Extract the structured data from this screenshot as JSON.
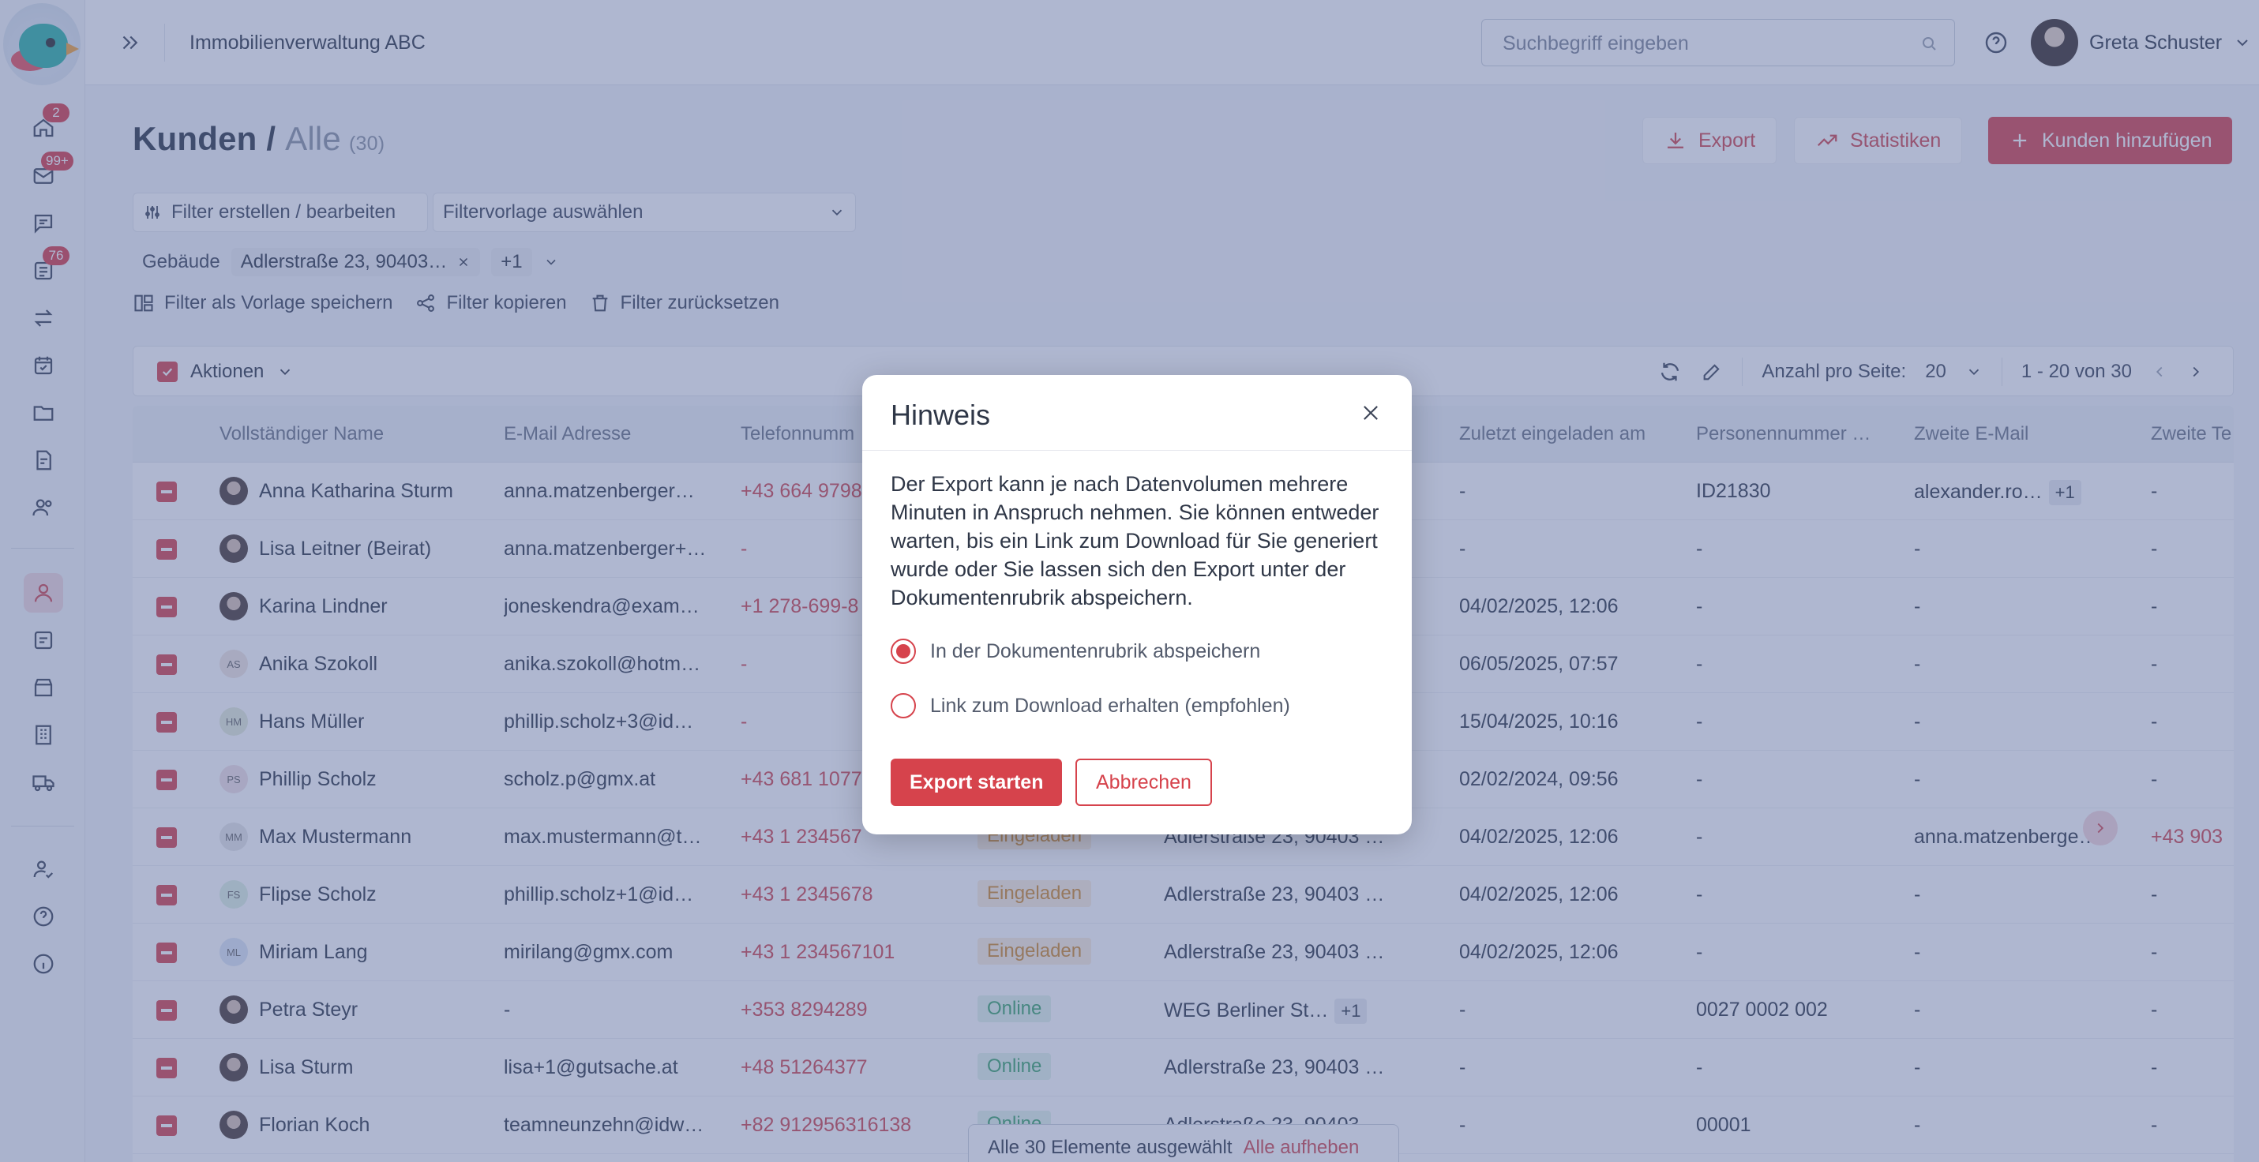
{
  "sidebar": {
    "badges": {
      "home": "2",
      "mail": "99+",
      "tasks": "76"
    }
  },
  "topbar": {
    "app_name": "Immobilienverwaltung ABC",
    "search_placeholder": "Suchbegriff eingeben",
    "user_name": "Greta Schuster"
  },
  "page": {
    "title": "Kunden",
    "separator": " / ",
    "subtitle": "Alle",
    "count": "(30)",
    "export_label": "Export",
    "stats_label": "Statistiken",
    "add_label": "Kunden hinzufügen"
  },
  "filters": {
    "edit_label": "Filter erstellen / bearbeiten",
    "template_placeholder": "Filtervorlage auswählen",
    "building_label": "Gebäude",
    "building_value": "Adlerstraße 23, 90403…",
    "more_count": "+1",
    "save_template": "Filter als Vorlage speichern",
    "copy_filter": "Filter kopieren",
    "reset_filter": "Filter zurücksetzen"
  },
  "toolbar": {
    "actions_label": "Aktionen",
    "per_page_label": "Anzahl pro Seite:",
    "per_page_value": "20",
    "range": "1 - 20 von 30"
  },
  "table": {
    "headers": [
      "Vollständiger Name",
      "E-Mail Adresse",
      "Telefonnumm",
      "Zuletzt eingeladen am",
      "Personennummer …",
      "Zweite E-Mail",
      "Zweite Te"
    ],
    "rows": [
      {
        "name": "Anna Katharina Sturm",
        "email": "anna.matzenberger…",
        "phone": "+43 664 9798",
        "status": "",
        "building": "",
        "invited": "-",
        "pnr": "ID21830",
        "email2": "alexander.ro…",
        "email2_more": "+1",
        "phone2": "-",
        "avatar": "photo"
      },
      {
        "name": "Lisa Leitner (Beirat)",
        "email": "anna.matzenberger+…",
        "phone": "-",
        "status": "",
        "building": "",
        "invited": "-",
        "pnr": "-",
        "email2": "-",
        "email2_more": "",
        "phone2": "-",
        "avatar": "photo"
      },
      {
        "name": "Karina Lindner",
        "email": "joneskendra@exam…",
        "phone": "+1 278-699-8",
        "status": "",
        "building": "",
        "invited": "04/02/2025, 12:06",
        "pnr": "-",
        "email2": "-",
        "email2_more": "",
        "phone2": "-",
        "avatar": "photo"
      },
      {
        "name": "Anika Szokoll",
        "email": "anika.szokoll@hotm…",
        "phone": "-",
        "status": "",
        "building": "",
        "invited": "06/05/2025, 07:57",
        "pnr": "-",
        "email2": "-",
        "email2_more": "",
        "phone2": "-",
        "avatar": "AS"
      },
      {
        "name": "Hans Müller",
        "email": "phillip.scholz+3@id…",
        "phone": "-",
        "status": "",
        "building": "",
        "invited": "15/04/2025, 10:16",
        "pnr": "-",
        "email2": "-",
        "email2_more": "",
        "phone2": "-",
        "avatar": "HM"
      },
      {
        "name": "Phillip Scholz",
        "email": "scholz.p@gmx.at",
        "phone": "+43 681 1077",
        "status": "",
        "building": "",
        "invited": "02/02/2024, 09:56",
        "pnr": "-",
        "email2": "-",
        "email2_more": "",
        "phone2": "-",
        "avatar": "PS"
      },
      {
        "name": "Max Mustermann",
        "email": "max.mustermann@t…",
        "phone": "+43 1 234567",
        "status": "Eingeladen",
        "building": "Adlerstraße 23, 90403 …",
        "invited": "04/02/2025, 12:06",
        "pnr": "-",
        "email2": "anna.matzenberge…",
        "email2_more": "",
        "phone2": "+43 903",
        "avatar": "MM"
      },
      {
        "name": "Flipse Scholz",
        "email": "phillip.scholz+1@id…",
        "phone": "+43 1 2345678",
        "status": "Eingeladen",
        "building": "Adlerstraße 23, 90403 …",
        "invited": "04/02/2025, 12:06",
        "pnr": "-",
        "email2": "-",
        "email2_more": "",
        "phone2": "-",
        "avatar": "FS"
      },
      {
        "name": "Miriam Lang",
        "email": "mirilang@gmx.com",
        "phone": "+43 1 234567101",
        "status": "Eingeladen",
        "building": "Adlerstraße 23, 90403 …",
        "invited": "04/02/2025, 12:06",
        "pnr": "-",
        "email2": "-",
        "email2_more": "",
        "phone2": "-",
        "avatar": "ML"
      },
      {
        "name": "Petra Steyr",
        "email": "-",
        "phone": "+353 8294289",
        "status": "Online",
        "building": "WEG Berliner St…",
        "building_more": "+1",
        "invited": "-",
        "pnr": "0027 0002 002",
        "email2": "-",
        "email2_more": "",
        "phone2": "-",
        "avatar": "photo"
      },
      {
        "name": "Lisa Sturm",
        "email": "lisa+1@gutsache.at",
        "phone": "+48 51264377",
        "status": "Online",
        "building": "Adlerstraße 23, 90403 …",
        "invited": "-",
        "pnr": "-",
        "email2": "-",
        "email2_more": "",
        "phone2": "-",
        "avatar": "photo"
      },
      {
        "name": "Florian Koch",
        "email": "teamneunzehn@idw…",
        "phone": "+82 912956316138",
        "status": "Online",
        "building": "Adlerstraße 23, 90403 …",
        "invited": "-",
        "pnr": "00001",
        "email2": "-",
        "email2_more": "",
        "phone2": "-",
        "avatar": "photo"
      }
    ]
  },
  "bulk": {
    "selected_text": "Alle 30 Elemente ausgewählt",
    "clear_label": "Alle aufheben"
  },
  "modal": {
    "title": "Hinweis",
    "text": "Der Export kann je nach Datenvolumen mehrere Minuten in Anspruch nehmen. Sie können entweder warten, bis ein Link zum Download für Sie generiert wurde oder Sie lassen sich den Export unter der Dokumentenrubrik abspeichern.",
    "option_save": "In der Dokumentenrubrik abspeichern",
    "option_link": "Link zum Download erhalten (empfohlen)",
    "start_label": "Export starten",
    "cancel_label": "Abbrechen"
  },
  "colors": {
    "accent": "#d6434c",
    "overlay": "rgba(86,102,156,0.47)"
  }
}
